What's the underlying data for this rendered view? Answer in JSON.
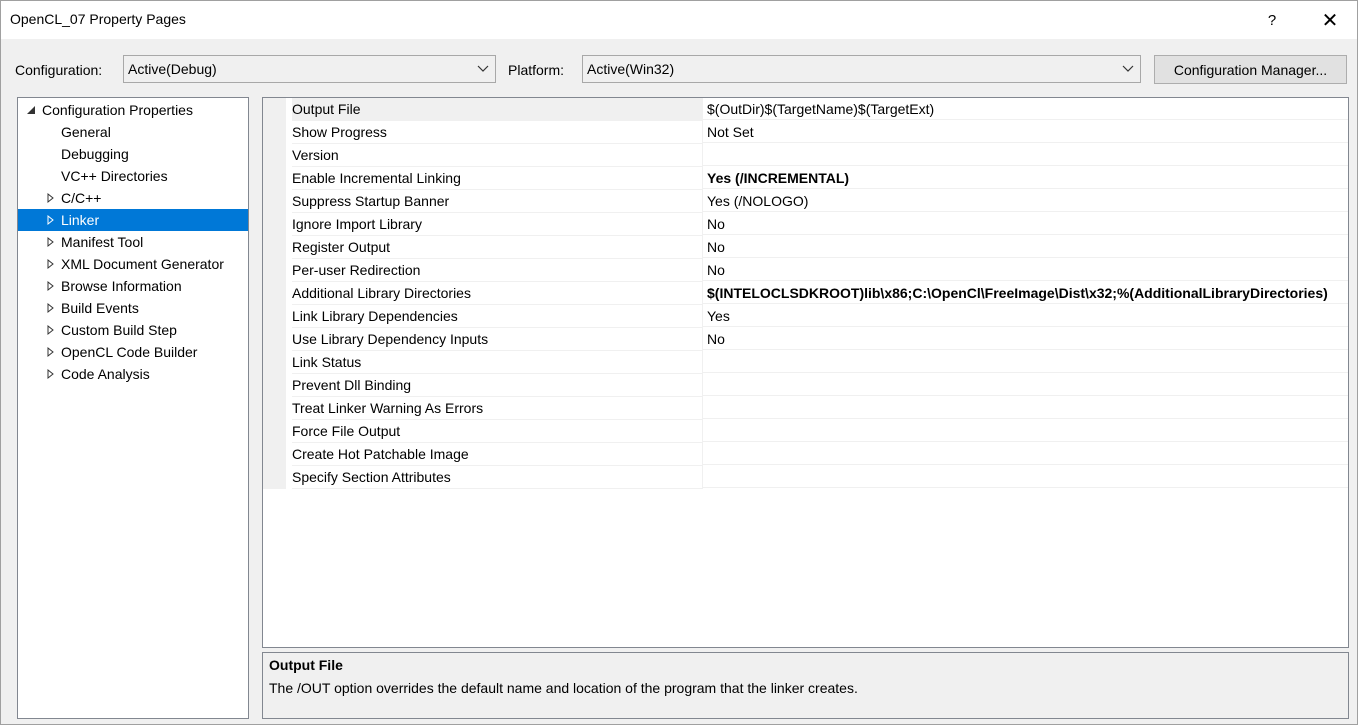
{
  "window": {
    "title": "OpenCL_07 Property Pages",
    "help_label": "?",
    "close_label": "✕"
  },
  "toolbar": {
    "configuration_label": "Configuration:",
    "configuration_value": "Active(Debug)",
    "platform_label": "Platform:",
    "platform_value": "Active(Win32)",
    "config_manager_label": "Configuration Manager..."
  },
  "tree": {
    "items": [
      {
        "label": "Configuration Properties",
        "expander": "expanded"
      },
      {
        "label": "General",
        "expander": "none"
      },
      {
        "label": "Debugging",
        "expander": "none"
      },
      {
        "label": "VC++ Directories",
        "expander": "none"
      },
      {
        "label": "C/C++",
        "expander": "collapsed"
      },
      {
        "label": "Linker",
        "expander": "collapsed",
        "selected": true
      },
      {
        "label": "Manifest Tool",
        "expander": "collapsed"
      },
      {
        "label": "XML Document Generator",
        "expander": "collapsed"
      },
      {
        "label": "Browse Information",
        "expander": "collapsed"
      },
      {
        "label": "Build Events",
        "expander": "collapsed"
      },
      {
        "label": "Custom Build Step",
        "expander": "collapsed"
      },
      {
        "label": "OpenCL Code Builder",
        "expander": "collapsed"
      },
      {
        "label": "Code Analysis",
        "expander": "collapsed"
      }
    ]
  },
  "grid": {
    "rows": [
      {
        "name": "Output File",
        "value": "$(OutDir)$(TargetName)$(TargetExt)",
        "bold": false
      },
      {
        "name": "Show Progress",
        "value": "Not Set",
        "bold": false
      },
      {
        "name": "Version",
        "value": "",
        "bold": false
      },
      {
        "name": "Enable Incremental Linking",
        "value": "Yes (/INCREMENTAL)",
        "bold": true
      },
      {
        "name": "Suppress Startup Banner",
        "value": "Yes (/NOLOGO)",
        "bold": false
      },
      {
        "name": "Ignore Import Library",
        "value": "No",
        "bold": false
      },
      {
        "name": "Register Output",
        "value": "No",
        "bold": false
      },
      {
        "name": "Per-user Redirection",
        "value": "No",
        "bold": false
      },
      {
        "name": "Additional Library Directories",
        "value": "$(INTELOCLSDKROOT)lib\\x86;C:\\OpenCl\\FreeImage\\Dist\\x32;%(AdditionalLibraryDirectories)",
        "bold": true
      },
      {
        "name": "Link Library Dependencies",
        "value": "Yes",
        "bold": false
      },
      {
        "name": "Use Library Dependency Inputs",
        "value": "No",
        "bold": false
      },
      {
        "name": "Link Status",
        "value": "",
        "bold": false
      },
      {
        "name": "Prevent Dll Binding",
        "value": "",
        "bold": false
      },
      {
        "name": "Treat Linker Warning As Errors",
        "value": "",
        "bold": false
      },
      {
        "name": "Force File Output",
        "value": "",
        "bold": false
      },
      {
        "name": "Create Hot Patchable Image",
        "value": "",
        "bold": false
      },
      {
        "name": "Specify Section Attributes",
        "value": "",
        "bold": false
      }
    ]
  },
  "description": {
    "title": "Output File",
    "text": "The /OUT option overrides the default name and location of the program that the linker creates."
  },
  "colors": {
    "selection": "#0078d7",
    "background": "#f0f0f0"
  }
}
